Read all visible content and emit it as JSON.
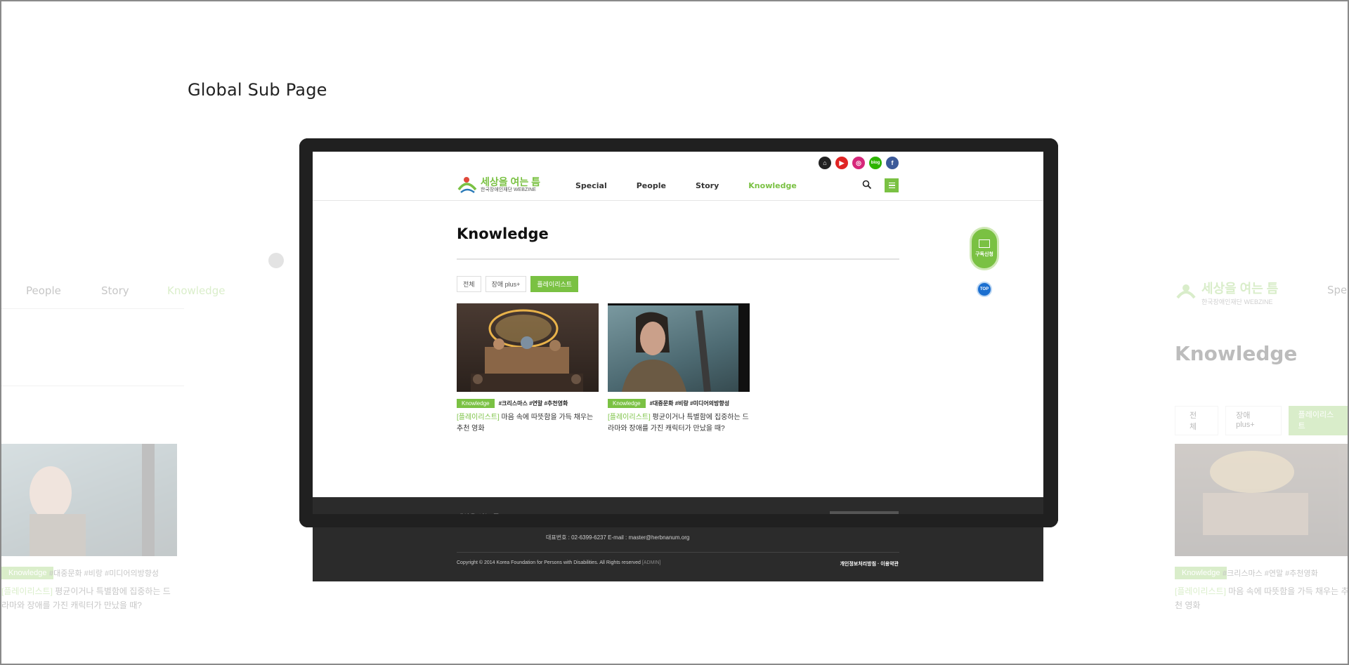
{
  "page": {
    "heading": "Global Sub Page"
  },
  "site": {
    "logo": {
      "name": "세상을 여는 틈",
      "sub": "한국장애인재단 WEBZINE"
    },
    "social": [
      "home",
      "youtube",
      "instagram",
      "blog",
      "facebook"
    ],
    "social_labels": {
      "home": "⌂",
      "youtube": "▶",
      "instagram": "◎",
      "blog": "blog",
      "facebook": "f"
    },
    "nav": [
      {
        "label": "Special"
      },
      {
        "label": "People"
      },
      {
        "label": "Story"
      },
      {
        "label": "Knowledge",
        "active": true
      }
    ],
    "title": "Knowledge",
    "tabs": [
      {
        "label": "전체"
      },
      {
        "label": "장애 plus+"
      },
      {
        "label": "플레이리스트",
        "active": true
      }
    ],
    "cards": [
      {
        "tag": "Knowledge",
        "hashtags": "#크리스마스 #연말 #추천영화",
        "bracket": "[플레이리스트]",
        "title": " 마음 속에 따뜻함을 가득 채우는 추천 영화"
      },
      {
        "tag": "Knowledge",
        "hashtags": "#대중문화 #비랑 #미디어의방향성",
        "bracket": "[플레이리스트]",
        "title": " 평균이거나 특별함에 집중하는 드라마와 장애를 가진 캐릭터가 만났을 때?"
      }
    ],
    "subscribe": "구독신청",
    "top": "TOP",
    "footer": {
      "tel": "대표번호 : 02-6399-6237  E-mail : master@herbnanum.org",
      "copyright": "Copyright © 2014 Korea Foundation for Persons with Disabilities. All Rights reserved",
      "admin": "[ADMIN]",
      "links": "개인정보처리방침 · 이용약관"
    }
  },
  "ghost_left": {
    "nav": [
      "People",
      "Story",
      "Knowledge"
    ],
    "tag": "Knowledge",
    "hashtags": "#대중문화 #비랑 #미디어의방향성",
    "bracket": "[플레이리스트]",
    "title": " 평균이거나 특별함에 집중하는 드라마와 장애를 가진 캐릭터가 만났을 때?"
  },
  "ghost_right": {
    "logo": "세상을 여는 틈",
    "logo_sub": "한국장애인재단 WEBZINE",
    "nav_cut": "Spec",
    "title": "Knowledge",
    "tabs": [
      "전체",
      "장애 plus+",
      "플레이리스트"
    ],
    "tag": "Knowledge",
    "hashtags": "#크리스마스 #연말 #추천영화",
    "bracket": "[플레이리스트]",
    "title_text": " 마음 속에 따뜻함을 가득 채우는 추천 영화"
  },
  "colors": {
    "accent": "#7ac143",
    "dark": "#202020",
    "footer": "#2b2b2b",
    "top_button": "#1b6fd0"
  }
}
